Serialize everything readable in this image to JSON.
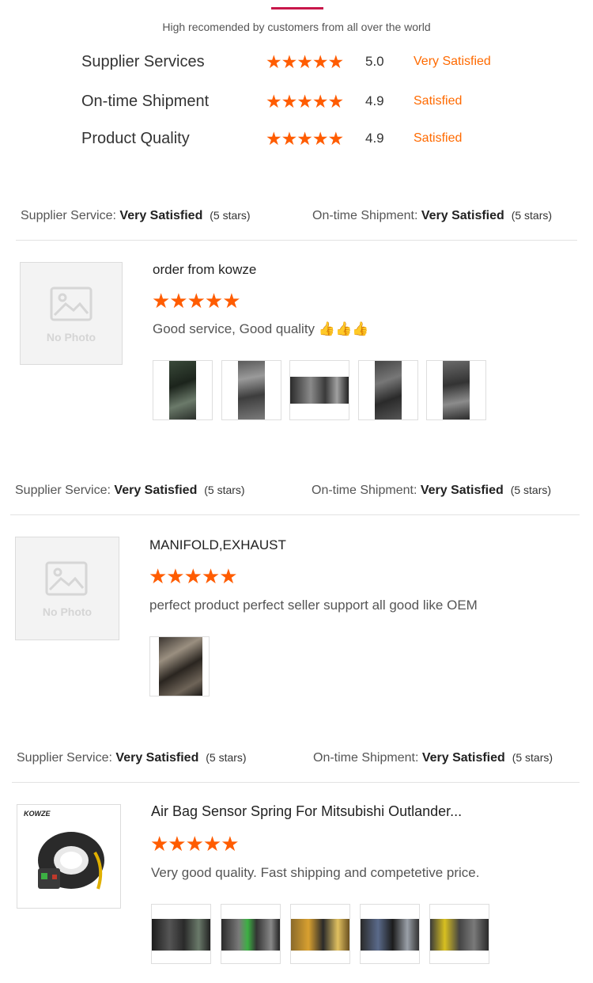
{
  "summary": {
    "subtitle": "High recomended by customers from all over the world",
    "stars": "★★★★★",
    "ratings": [
      {
        "label": "Supplier Services",
        "score": "5.0",
        "status": "Very Satisfied"
      },
      {
        "label": "On-time Shipment",
        "score": "4.9",
        "status": "Satisfied"
      },
      {
        "label": "Product Quality",
        "score": "4.9",
        "status": "Satisfied"
      }
    ]
  },
  "reviews": [
    {
      "supplier_label": "Supplier Service:",
      "supplier_value": "Very Satisfied",
      "supplier_stars": "(5 stars)",
      "shipment_label": "On-time Shipment:",
      "shipment_value": "Very Satisfied",
      "shipment_stars": "(5 stars)",
      "avatar_text": "No Photo",
      "title": "order from kowze",
      "stars": "★★★★★",
      "text": "Good service, Good quality 👍👍👍",
      "thumbnail_count": 5
    },
    {
      "supplier_label": "Supplier Service:",
      "supplier_value": "Very Satisfied",
      "supplier_stars": "(5 stars)",
      "shipment_label": "On-time Shipment:",
      "shipment_value": "Very Satisfied",
      "shipment_stars": "(5 stars)",
      "avatar_text": "No Photo",
      "title": "MANIFOLD,EXHAUST",
      "stars": "★★★★★",
      "text": "perfect product perfect seller support all good like OEM",
      "thumbnail_count": 1
    },
    {
      "supplier_label": "Supplier Service:",
      "supplier_value": "Very Satisfied",
      "supplier_stars": "(5 stars)",
      "shipment_label": "On-time Shipment:",
      "shipment_value": "Very Satisfied",
      "shipment_stars": "(5 stars)",
      "brand_logo": "KOWZE",
      "title": "Air Bag Sensor Spring For Mitsubishi Outlander...",
      "stars": "★★★★★",
      "text": "Very good quality. Fast shipping and competetive price.",
      "thumbnail_count": 5
    }
  ],
  "colors": {
    "accent": "#c8174a",
    "star": "#ff5c00",
    "status": "#ff6a00"
  }
}
